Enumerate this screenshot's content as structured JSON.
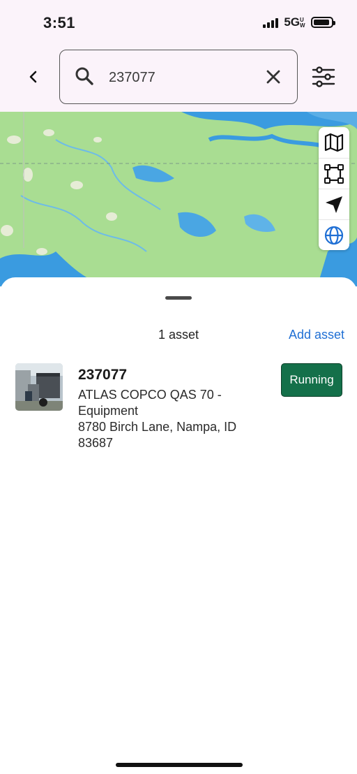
{
  "status_bar": {
    "time": "3:51",
    "network": "5G",
    "network_suffix": "UW"
  },
  "search": {
    "value": "237077",
    "placeholder": "Search"
  },
  "icons": {
    "back": "chevron-left-icon",
    "search": "search-icon",
    "clear": "close-icon",
    "filter": "sliders-icon",
    "map_tools": [
      "map-icon",
      "area-select-icon",
      "locate-arrow-icon",
      "globe-icon"
    ]
  },
  "colors": {
    "accent": "#1f6fd4",
    "status_running": "#14704a",
    "map_land": "#a9dd92",
    "map_water": "#3a9be0"
  },
  "sheet": {
    "count_label": "1 asset",
    "add_label": "Add asset",
    "assets": [
      {
        "id": "237077",
        "description": "ATLAS COPCO QAS 70 - Equipment",
        "address": "8780 Birch Lane, Nampa, ID 83687",
        "status": "Running"
      }
    ]
  }
}
